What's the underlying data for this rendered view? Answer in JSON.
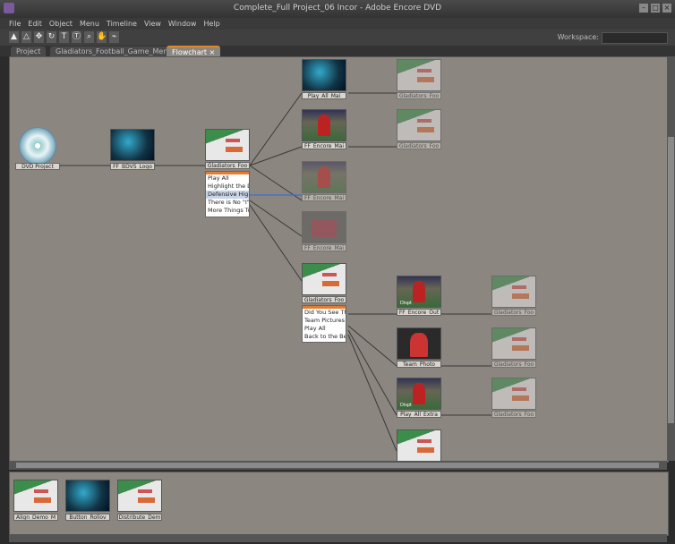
{
  "window": {
    "title": "Complete_Full Project_06 Incor - Adobe Encore DVD"
  },
  "menu": [
    "File",
    "Edit",
    "Object",
    "Menu",
    "Timeline",
    "View",
    "Window",
    "Help"
  ],
  "toolbar": {
    "tools": [
      "selection-tool",
      "direct-select-tool",
      "move-tool",
      "rotate-tool",
      "text-tool",
      "vertical-text-tool",
      "zoom-tool",
      "hand-tool",
      "link-tool"
    ],
    "workspace_label": "Workspace:"
  },
  "tabs": [
    {
      "label": "Project"
    },
    {
      "label": "Gladiators_Football_Game_Menu"
    },
    {
      "label": "Flowchart ×"
    }
  ],
  "flowchart": {
    "dvd": "DVD Project",
    "intro": "FF_BDVS_Logo",
    "main_menu": "Gladiators_Foo",
    "main_menu_buttons": [
      "Play All",
      "Highlight the D",
      "Defensive High",
      "There is No \"I\"",
      "More Things To"
    ],
    "row_nodes": [
      "Play_All_Mai",
      "FF_Encore_Mai",
      "FF_Encore_Mai",
      "FF_Encore_Mai"
    ],
    "right_menus_top": [
      "Gladiators_Foo",
      "Gladiators_Foo"
    ],
    "sub_menu": "Gladiators_Foo",
    "sub_menu_buttons": [
      "Did You See Th",
      "Team Pictures",
      "Play All",
      "Back to the Beg"
    ],
    "sub_nodes": [
      "FF_Encore_Out",
      "Team_Photo",
      "Play_All_Extra"
    ],
    "sub_right_menus": [
      "Gladiators_Foo",
      "Gladiators_Foo",
      "Gladiators_Foo"
    ],
    "thumb_badge": "Dispt"
  },
  "bottom_panel": {
    "items": [
      "Align_Demo_M",
      "Button_Rollov",
      "Distribute_Dem"
    ]
  }
}
